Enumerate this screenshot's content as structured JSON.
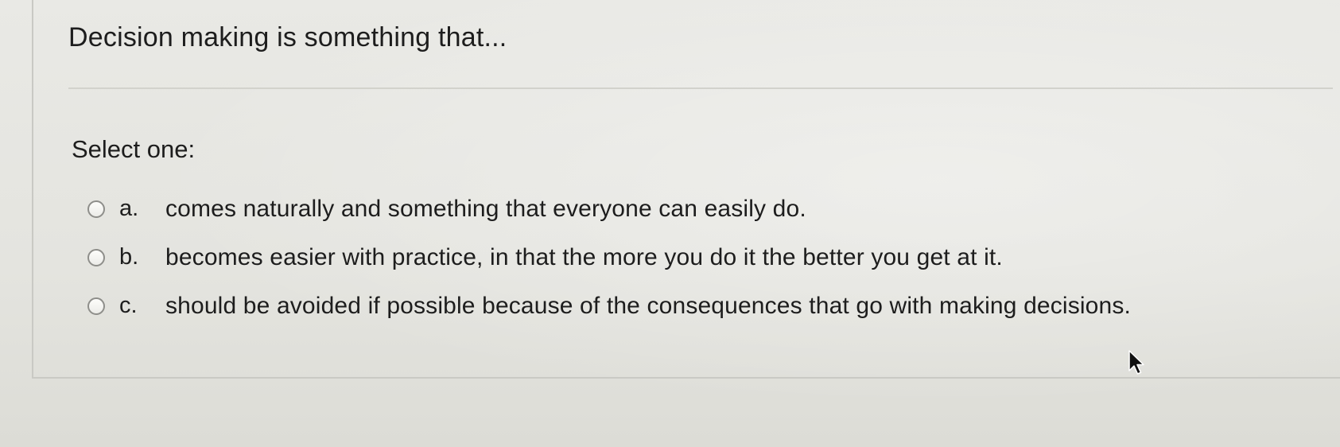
{
  "question": {
    "text": "Decision making is something that..."
  },
  "prompt": "Select one:",
  "options": [
    {
      "letter": "a.",
      "text": "comes naturally and something that everyone can easily do."
    },
    {
      "letter": "b.",
      "text": "becomes easier with practice, in that the more you do it the better you get at it."
    },
    {
      "letter": "c.",
      "text": "should be avoided if possible because of the consequences that go with making decisions."
    }
  ],
  "icons": {
    "radio": "radio-button-icon",
    "cursor": "mouse-pointer-icon"
  },
  "colors": {
    "background": "#e6e6e2",
    "text": "#1d1d1d",
    "border": "#c9c9c4"
  }
}
